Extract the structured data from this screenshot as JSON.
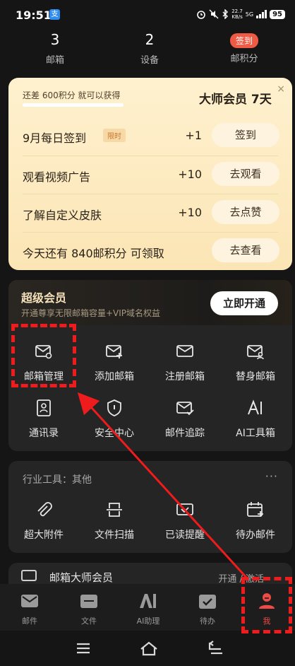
{
  "status_bar": {
    "time": "19:51",
    "app_badge": "支",
    "net_speed": "22.7",
    "net_unit": "KB/s",
    "signal": "5G",
    "battery": "95"
  },
  "stats": [
    {
      "value": "3",
      "label": "邮箱"
    },
    {
      "value": "2",
      "label": "设备"
    },
    {
      "badge": "签到",
      "label": "邮积分"
    }
  ],
  "points_card": {
    "close_icon": "×",
    "subtitle": "还差 600积分 就可以获得",
    "reward": "大师会员 7天",
    "progress": 0.6,
    "tasks": [
      {
        "name": "9月每日签到",
        "tag": "限时",
        "points": "+1",
        "button": "签到"
      },
      {
        "name": "观看视频广告",
        "points": "+10",
        "button": "去观看"
      },
      {
        "name": "了解自定义皮肤",
        "points": "+10",
        "button": "去点赞"
      },
      {
        "name": "今天还有 840邮积分 可领取",
        "button": "去查看"
      }
    ]
  },
  "vip": {
    "title": "超级会员",
    "subtitle": "开通尊享无限邮箱容量+VIP域名权益",
    "button": "立即开通"
  },
  "tools": [
    {
      "label": "邮箱管理",
      "icon": "mail-settings-icon"
    },
    {
      "label": "添加邮箱",
      "icon": "mail-add-icon"
    },
    {
      "label": "注册邮箱",
      "icon": "mail-icon"
    },
    {
      "label": "替身邮箱",
      "icon": "mail-user-icon"
    },
    {
      "label": "通讯录",
      "icon": "contacts-icon"
    },
    {
      "label": "安全中心",
      "icon": "shield-icon"
    },
    {
      "label": "邮件追踪",
      "icon": "mail-check-icon"
    },
    {
      "label": "AI工具箱",
      "icon": "ai-icon"
    }
  ],
  "industry": {
    "title": "行业工具：其他",
    "more": "···",
    "items": [
      {
        "label": "超大附件",
        "icon": "paperclip-icon"
      },
      {
        "label": "文件扫描",
        "icon": "scan-icon"
      },
      {
        "label": "已读提醒",
        "icon": "read-receipt-icon"
      },
      {
        "label": "待办邮件",
        "icon": "calendar-add-icon"
      }
    ]
  },
  "member_row": {
    "title": "邮箱大师会员",
    "right": "开通 / 激活"
  },
  "tabbar": [
    {
      "label": "邮件",
      "icon": "mail-icon"
    },
    {
      "label": "文件",
      "icon": "folder-icon"
    },
    {
      "label": "AI助理",
      "icon": "ai-icon"
    },
    {
      "label": "待办",
      "icon": "todo-icon"
    },
    {
      "label": "我",
      "icon": "profile-icon",
      "active": true
    }
  ],
  "colors": {
    "accent": "#ee4a46",
    "card": "#fbe5b5",
    "panel": "#252525",
    "highlight": "#ee1c1c"
  }
}
